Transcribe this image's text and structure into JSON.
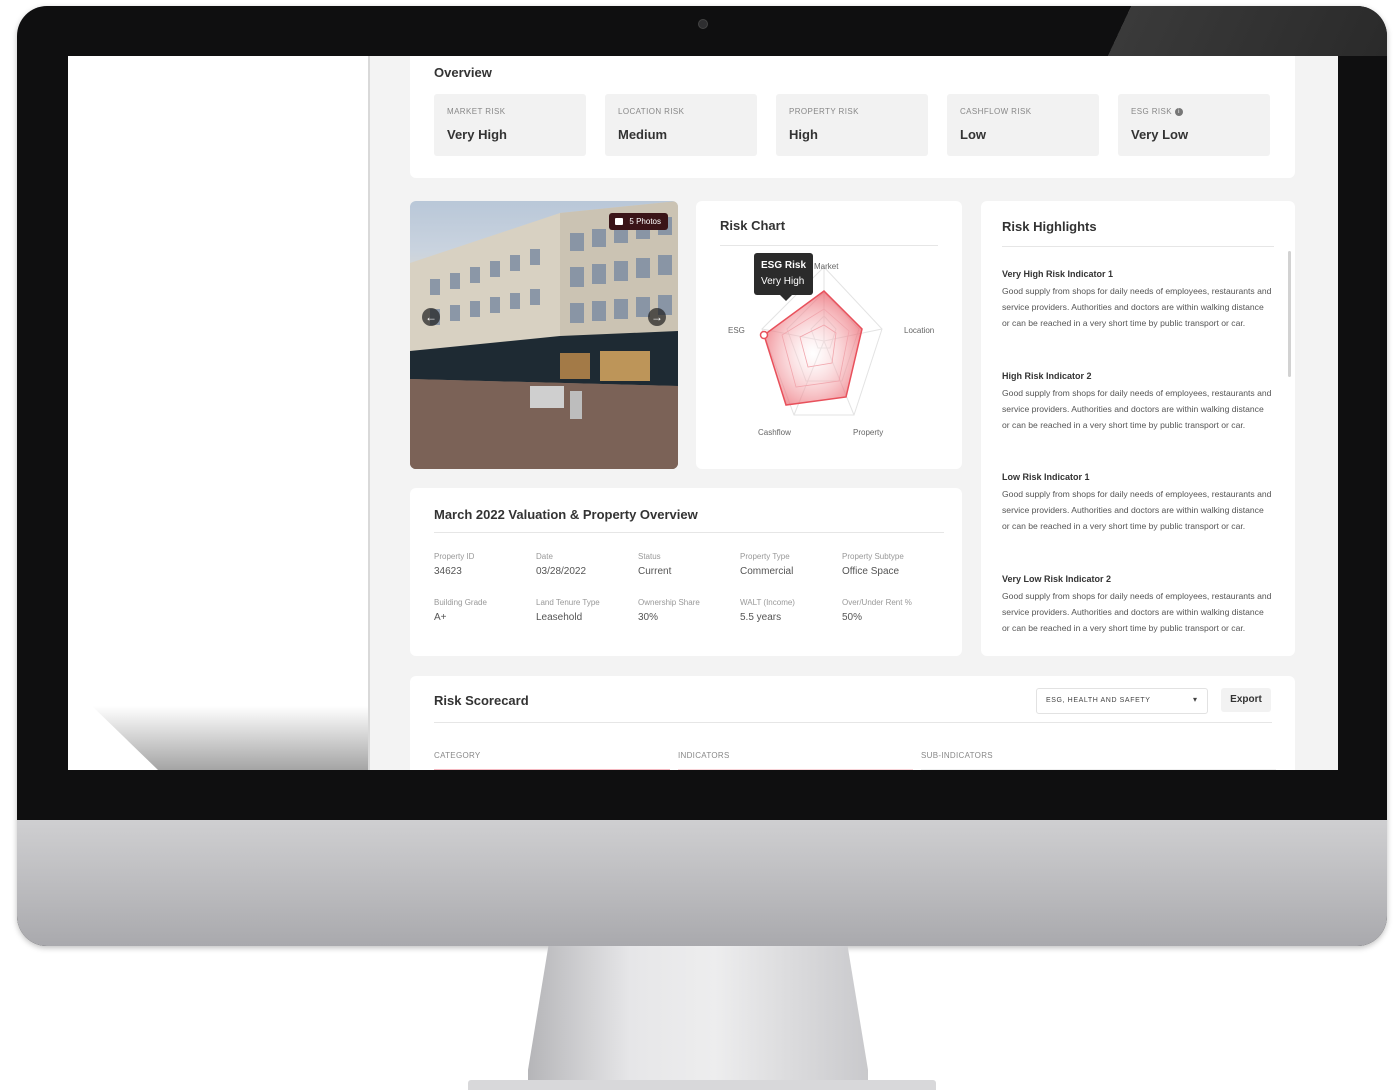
{
  "overview": {
    "title": "Overview",
    "risks": [
      {
        "label": "MARKET RISK",
        "value": "Very High"
      },
      {
        "label": "LOCATION RISK",
        "value": "Medium"
      },
      {
        "label": "PROPERTY RISK",
        "value": "High"
      },
      {
        "label": "CASHFLOW RISK",
        "value": "Low"
      },
      {
        "label": "ESG RISK",
        "value": "Very Low"
      }
    ]
  },
  "photo": {
    "badge": "5 Photos",
    "prev_icon": "arrow-left-icon",
    "next_icon": "arrow-right-icon"
  },
  "risk_chart": {
    "title": "Risk Chart",
    "axes": [
      "Market",
      "Location",
      "Property",
      "Cashflow",
      "ESG"
    ],
    "tooltip": {
      "title": "ESG Risk",
      "value": "Very High"
    }
  },
  "highlights": {
    "title": "Risk Highlights",
    "items": [
      {
        "title": "Very High Risk Indicator 1",
        "text": "Good supply from shops for daily needs of employees, restaurants and service providers. Authorities and doctors are within walking distance or can be reached in a very short time by public transport or car."
      },
      {
        "title": "High Risk Indicator 2",
        "text": "Good supply from shops for daily needs of employees, restaurants and service providers. Authorities and doctors are within walking distance or can be reached in a very short time by public transport or car."
      },
      {
        "title": "Low Risk Indicator 1",
        "text": "Good supply from shops for daily needs of employees, restaurants and service providers. Authorities and doctors are within walking distance or can be reached in a very short time by public transport or car."
      },
      {
        "title": "Very Low Risk Indicator 2",
        "text": "Good supply from shops for daily needs of employees, restaurants and service providers. Authorities and doctors are within walking distance or can be reached in a very short time by public transport or car."
      }
    ]
  },
  "valuation": {
    "title": "March 2022 Valuation & Property Overview",
    "fields": [
      {
        "label": "Property ID",
        "value": "34623"
      },
      {
        "label": "Date",
        "value": "03/28/2022"
      },
      {
        "label": "Status",
        "value": "Current"
      },
      {
        "label": "Property Type",
        "value": "Commercial"
      },
      {
        "label": "Property Subtype",
        "value": "Office Space"
      },
      {
        "label": "Building Grade",
        "value": "A+"
      },
      {
        "label": "Land Tenure Type",
        "value": "Leasehold"
      },
      {
        "label": "Ownership Share",
        "value": "30%"
      },
      {
        "label": "WALT (Income)",
        "value": "5.5 years"
      },
      {
        "label": "Over/Under Rent %",
        "value": "50%"
      }
    ]
  },
  "scorecard": {
    "title": "Risk Scorecard",
    "select_value": "ESG, HEALTH AND SAFETY",
    "export_label": "Export",
    "columns": [
      "CATEGORY",
      "INDICATORS",
      "SUB-INDICATORS"
    ]
  },
  "colors": {
    "accent": "#e8505b",
    "badge": "#3a1418"
  }
}
